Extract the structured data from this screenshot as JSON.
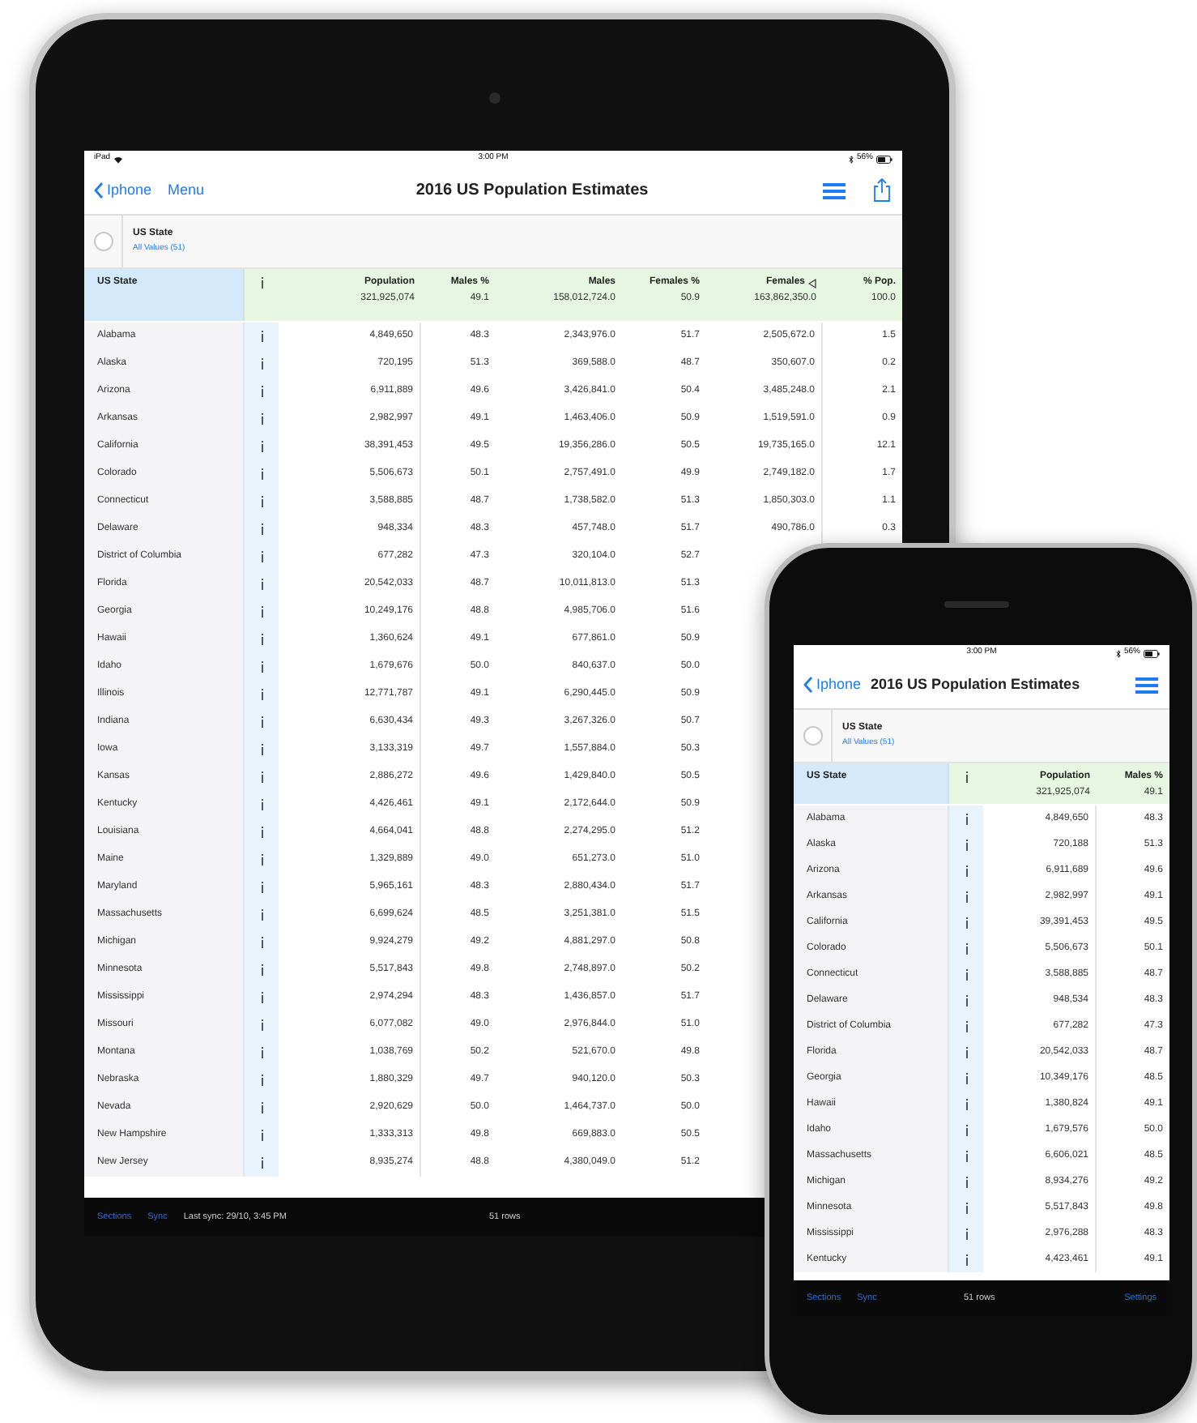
{
  "tablet": {
    "status_bar": {
      "carrier": "iPad",
      "time": "3:00 PM",
      "battery": "56%"
    },
    "nav": {
      "back": "Iphone",
      "menu": "Menu",
      "title": "2016 US Population Estimates"
    },
    "filter": {
      "field": "US State",
      "value": "All Values (51)"
    },
    "table": {
      "columns": [
        {
          "label": "US State"
        },
        {
          "label": "Population",
          "total": "321,925,074",
          "sorted": false
        },
        {
          "label": "Males %",
          "total": "49.1",
          "sorted": false
        },
        {
          "label": "Males",
          "total": "158,012,724.0",
          "sorted": false
        },
        {
          "label": "Females %",
          "total": "50.9",
          "sorted": false
        },
        {
          "label": "Females",
          "total": "163,862,350.0",
          "sorted": true
        },
        {
          "label": "% Pop.",
          "total": "100.0",
          "sorted": false
        }
      ],
      "rows": [
        {
          "cells": [
            "Alabama",
            "4,849,650",
            "48.3",
            "2,343,976.0",
            "51.7",
            "2,505,672.0",
            "1.5"
          ]
        },
        {
          "cells": [
            "Alaska",
            "720,195",
            "51.3",
            "369,588.0",
            "48.7",
            "350,607.0",
            "0.2"
          ]
        },
        {
          "cells": [
            "Arizona",
            "6,911,889",
            "49.6",
            "3,426,841.0",
            "50.4",
            "3,485,248.0",
            "2.1"
          ]
        },
        {
          "cells": [
            "Arkansas",
            "2,982,997",
            "49.1",
            "1,463,406.0",
            "50.9",
            "1,519,591.0",
            "0.9"
          ]
        },
        {
          "cells": [
            "California",
            "38,391,453",
            "49.5",
            "19,356,286.0",
            "50.5",
            "19,735,165.0",
            "12.1"
          ]
        },
        {
          "cells": [
            "Colorado",
            "5,506,673",
            "50.1",
            "2,757,491.0",
            "49.9",
            "2,749,182.0",
            "1.7"
          ]
        },
        {
          "cells": [
            "Connecticut",
            "3,588,885",
            "48.7",
            "1,738,582.0",
            "51.3",
            "1,850,303.0",
            "1.1"
          ]
        },
        {
          "cells": [
            "Delaware",
            "948,334",
            "48.3",
            "457,748.0",
            "51.7",
            "490,786.0",
            "0.3"
          ]
        },
        {
          "cells": [
            "District of Columbia",
            "677,282",
            "47.3",
            "320,104.0",
            "52.7"
          ]
        },
        {
          "cells": [
            "Florida",
            "20,542,033",
            "48.7",
            "10,011,813.0",
            "51.3"
          ]
        },
        {
          "cells": [
            "Georgia",
            "10,249,176",
            "48.8",
            "4,985,706.0",
            "51.6"
          ]
        },
        {
          "cells": [
            "Hawaii",
            "1,360,624",
            "49.1",
            "677,861.0",
            "50.9"
          ]
        },
        {
          "cells": [
            "Idaho",
            "1,679,676",
            "50.0",
            "840,637.0",
            "50.0"
          ]
        },
        {
          "cells": [
            "Illinois",
            "12,771,787",
            "49.1",
            "6,290,445.0",
            "50.9"
          ]
        },
        {
          "cells": [
            "Indiana",
            "6,630,434",
            "49.3",
            "3,267,326.0",
            "50.7"
          ]
        },
        {
          "cells": [
            "Iowa",
            "3,133,319",
            "49.7",
            "1,557,884.0",
            "50.3"
          ]
        },
        {
          "cells": [
            "Kansas",
            "2,886,272",
            "49.6",
            "1,429,840.0",
            "50.5"
          ]
        },
        {
          "cells": [
            "Kentucky",
            "4,426,461",
            "49.1",
            "2,172,644.0",
            "50.9"
          ]
        },
        {
          "cells": [
            "Louisiana",
            "4,664,041",
            "48.8",
            "2,274,295.0",
            "51.2"
          ]
        },
        {
          "cells": [
            "Maine",
            "1,329,889",
            "49.0",
            "651,273.0",
            "51.0"
          ]
        },
        {
          "cells": [
            "Maryland",
            "5,965,161",
            "48.3",
            "2,880,434.0",
            "51.7"
          ]
        },
        {
          "cells": [
            "Massachusetts",
            "6,699,624",
            "48.5",
            "3,251,381.0",
            "51.5"
          ]
        },
        {
          "cells": [
            "Michigan",
            "9,924,279",
            "49.2",
            "4,881,297.0",
            "50.8"
          ]
        },
        {
          "cells": [
            "Minnesota",
            "5,517,843",
            "49.8",
            "2,748,897.0",
            "50.2"
          ]
        },
        {
          "cells": [
            "Mississippi",
            "2,974,294",
            "48.3",
            "1,436,857.0",
            "51.7"
          ]
        },
        {
          "cells": [
            "Missouri",
            "6,077,082",
            "49.0",
            "2,976,844.0",
            "51.0"
          ]
        },
        {
          "cells": [
            "Montana",
            "1,038,769",
            "50.2",
            "521,670.0",
            "49.8"
          ]
        },
        {
          "cells": [
            "Nebraska",
            "1,880,329",
            "49.7",
            "940,120.0",
            "50.3"
          ]
        },
        {
          "cells": [
            "Nevada",
            "2,920,629",
            "50.0",
            "1,464,737.0",
            "50.0"
          ]
        },
        {
          "cells": [
            "New Hampshire",
            "1,333,313",
            "49.8",
            "669,883.0",
            "50.5"
          ]
        },
        {
          "cells": [
            "New Jersey",
            "8,935,274",
            "48.8",
            "4,380,049.0",
            "51.2"
          ]
        }
      ]
    },
    "toolbar": {
      "left": [
        {
          "label": "Sections",
          "kind": "link"
        },
        {
          "label": "Sync",
          "kind": "link"
        },
        {
          "label": "Last sync: 29/10, 3:45 PM",
          "kind": "text"
        }
      ],
      "center": "51 rows"
    }
  },
  "phone": {
    "status_bar": {
      "time": "3:00 PM",
      "battery": "56%"
    },
    "nav": {
      "back": "Iphone",
      "title": "2016 US Population Estimates"
    },
    "filter": {
      "field": "US State",
      "value": "All Values (51)"
    },
    "table": {
      "columns": [
        {
          "label": "US State"
        },
        {
          "label": "Population",
          "total": "321,925,074",
          "sorted": false
        },
        {
          "label": "Males %",
          "total": "49.1",
          "sorted": false
        }
      ],
      "rows": [
        {
          "cells": [
            "Alabama",
            "4,849,650",
            "48.3"
          ]
        },
        {
          "cells": [
            "Alaska",
            "720,188",
            "51.3"
          ]
        },
        {
          "cells": [
            "Arizona",
            "6,911,689",
            "49.6"
          ]
        },
        {
          "cells": [
            "Arkansas",
            "2,982,997",
            "49.1"
          ]
        },
        {
          "cells": [
            "California",
            "39,391,453",
            "49.5"
          ]
        },
        {
          "cells": [
            "Colorado",
            "5,506,673",
            "50.1"
          ]
        },
        {
          "cells": [
            "Connecticut",
            "3,588,885",
            "48.7"
          ]
        },
        {
          "cells": [
            "Delaware",
            "948,534",
            "48.3"
          ]
        },
        {
          "cells": [
            "District of Columbia",
            "677,282",
            "47.3"
          ]
        },
        {
          "cells": [
            "Florida",
            "20,542,033",
            "48.7"
          ]
        },
        {
          "cells": [
            "Georgia",
            "10,349,176",
            "48.5"
          ]
        },
        {
          "cells": [
            "Hawaii",
            "1,380,824",
            "49.1"
          ]
        },
        {
          "cells": [
            "Idaho",
            "1,679,576",
            "50.0"
          ]
        },
        {
          "cells": [
            "Massachusetts",
            "6,606,021",
            "48.5"
          ]
        },
        {
          "cells": [
            "Michigan",
            "8,934,276",
            "49.2"
          ]
        },
        {
          "cells": [
            "Minnesota",
            "5,517,843",
            "49.8"
          ]
        },
        {
          "cells": [
            "Mississippi",
            "2,976,288",
            "48.3"
          ]
        },
        {
          "cells": [
            "Kentucky",
            "4,423,461",
            "49.1"
          ]
        }
      ]
    },
    "toolbar": {
      "left": [
        {
          "label": "Sections",
          "kind": "link"
        },
        {
          "label": "Sync",
          "kind": "link"
        }
      ],
      "center": "51 rows",
      "right": [
        {
          "label": "Settings",
          "kind": "link"
        }
      ]
    }
  }
}
